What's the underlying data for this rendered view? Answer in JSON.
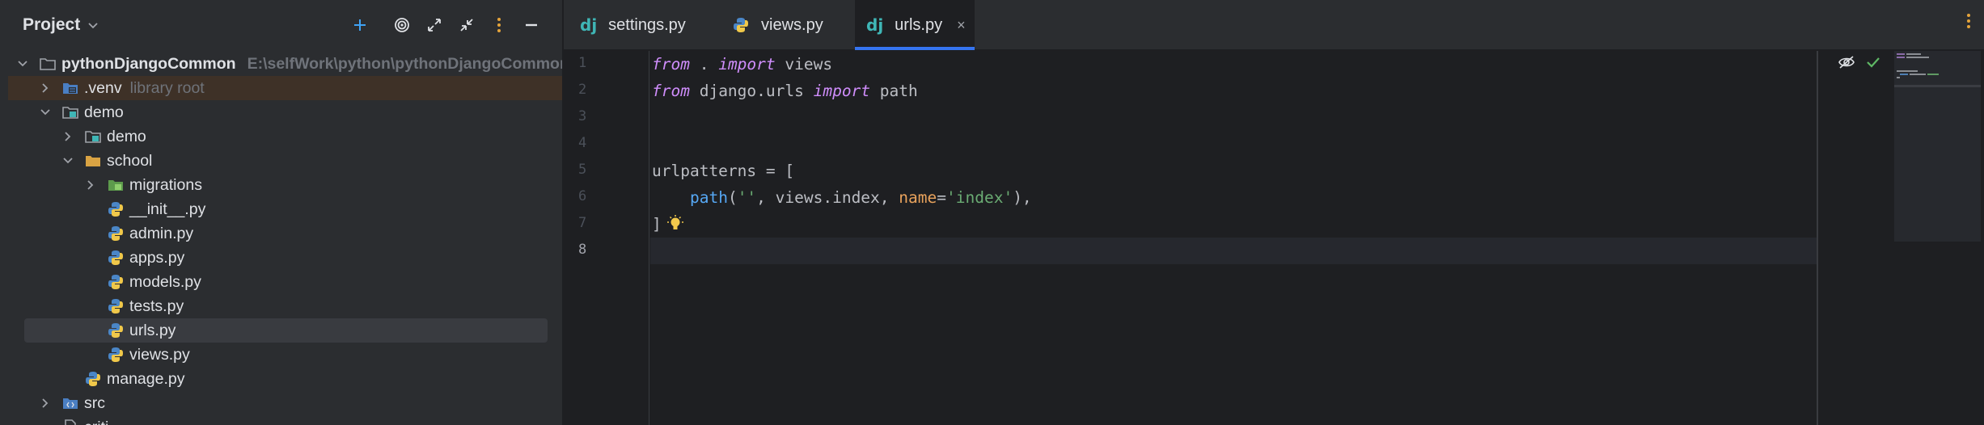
{
  "project_panel": {
    "title": "Project",
    "tree": [
      {
        "label": "pythonDjangoCommon",
        "hint": "E:\\selfWork\\python\\pythonDjangoCommon"
      },
      {
        "label": ".venv",
        "hint": "library root"
      },
      {
        "label": "demo"
      },
      {
        "label": "demo"
      },
      {
        "label": "school"
      },
      {
        "label": "migrations"
      },
      {
        "label": "__init__.py"
      },
      {
        "label": "admin.py"
      },
      {
        "label": "apps.py"
      },
      {
        "label": "models.py"
      },
      {
        "label": "tests.py"
      },
      {
        "label": "urls.py"
      },
      {
        "label": "views.py"
      },
      {
        "label": "manage.py"
      },
      {
        "label": "src"
      },
      {
        "label": "criti"
      }
    ]
  },
  "editor": {
    "tabs": [
      {
        "label": "settings.py",
        "icon": "django-icon"
      },
      {
        "label": "views.py",
        "icon": "python-icon"
      },
      {
        "label": "urls.py",
        "icon": "django-icon",
        "active": true
      }
    ],
    "tab_icon_text": "dj",
    "close_glyph": "×",
    "line_numbers": [
      "1",
      "2",
      "3",
      "4",
      "5",
      "6",
      "7",
      "8"
    ],
    "current_line": 8,
    "code": {
      "l1": {
        "kw1": "from",
        "t1": " . ",
        "kw2": "import",
        "t2": " views"
      },
      "l2": {
        "kw1": "from",
        "t1": " django.urls ",
        "kw2": "import",
        "t2": " path"
      },
      "l5": {
        "t1": "urlpatterns = ["
      },
      "l6": {
        "indent": "    ",
        "fn": "path",
        "t1": "(",
        "s1": "''",
        "t2": ", views.index, ",
        "kwarg": "name",
        "t3": "=",
        "s2": "'index'",
        "t4": "),"
      },
      "l7": {
        "t1": "]"
      }
    }
  },
  "colors": {
    "accent": "#3574f0",
    "keyword": "#cf8dfb",
    "function": "#56a8f5",
    "string": "#6aab73",
    "kwarg": "#e8a25c",
    "django": "#3fb6b6",
    "folder": "#d9a343",
    "venv_highlight": "#3e3127"
  }
}
